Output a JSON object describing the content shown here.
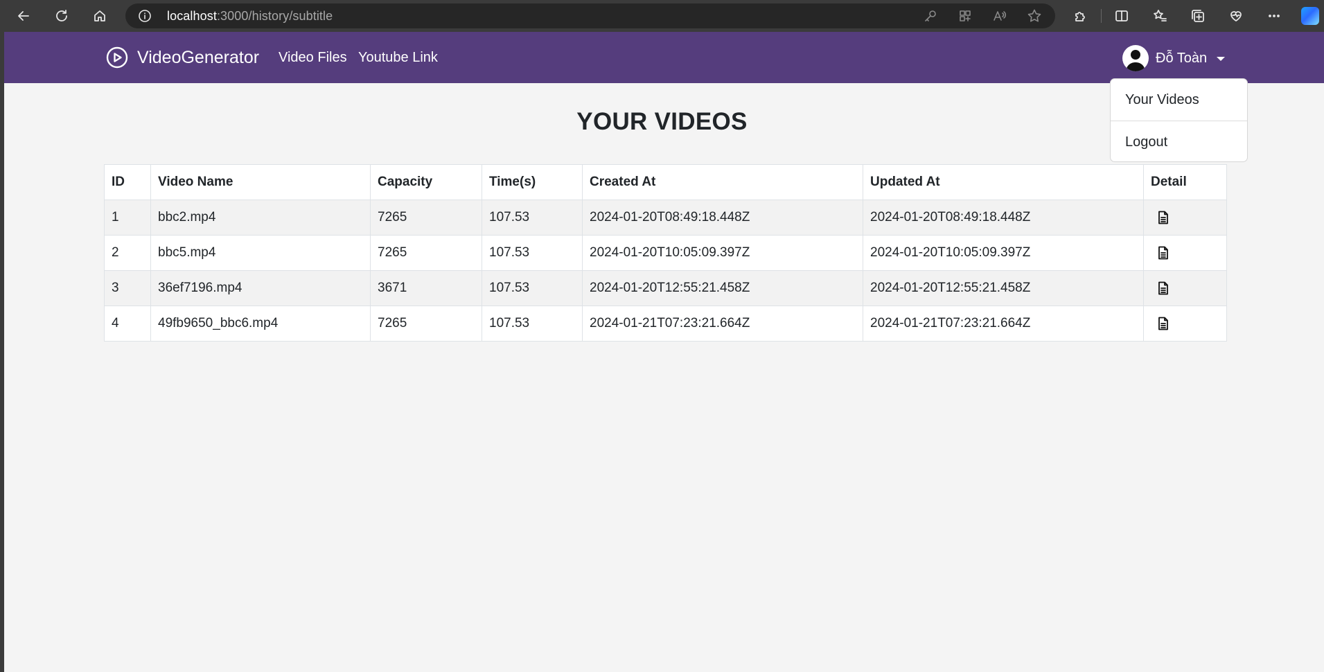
{
  "browser": {
    "url_host": "localhost",
    "url_path": ":3000/history/subtitle"
  },
  "navbar": {
    "brand": "VideoGenerator",
    "links": [
      "Video Files",
      "Youtube Link"
    ],
    "user_name": "Đỗ Toàn",
    "colors": {
      "navbar_bg": "#553d7d"
    }
  },
  "dropdown": {
    "items": [
      "Your Videos",
      "Logout"
    ]
  },
  "main": {
    "title": "YOUR VIDEOS",
    "columns": [
      "ID",
      "Video Name",
      "Capacity",
      "Time(s)",
      "Created At",
      "Updated At",
      "Detail"
    ],
    "rows": [
      {
        "id": "1",
        "name": "bbc2.mp4",
        "capacity": "7265",
        "time": "107.53",
        "created": "2024-01-20T08:49:18.448Z",
        "updated": "2024-01-20T08:49:18.448Z"
      },
      {
        "id": "2",
        "name": "bbc5.mp4",
        "capacity": "7265",
        "time": "107.53",
        "created": "2024-01-20T10:05:09.397Z",
        "updated": "2024-01-20T10:05:09.397Z"
      },
      {
        "id": "3",
        "name": "36ef7196.mp4",
        "capacity": "3671",
        "time": "107.53",
        "created": "2024-01-20T12:55:21.458Z",
        "updated": "2024-01-20T12:55:21.458Z"
      },
      {
        "id": "4",
        "name": "49fb9650_bbc6.mp4",
        "capacity": "7265",
        "time": "107.53",
        "created": "2024-01-21T07:23:21.664Z",
        "updated": "2024-01-21T07:23:21.664Z"
      }
    ]
  }
}
